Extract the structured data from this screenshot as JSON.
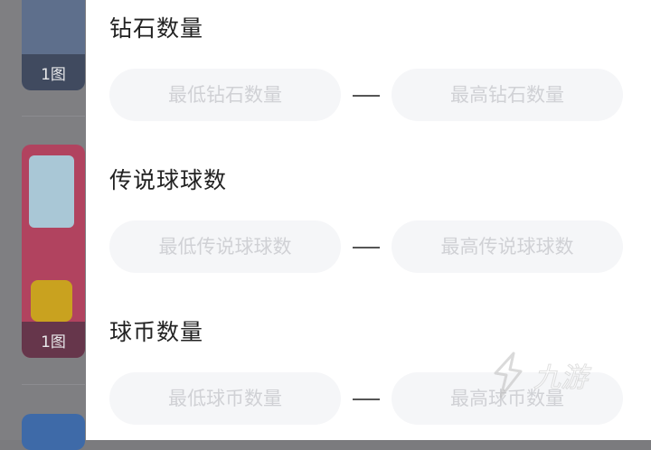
{
  "background": {
    "thumbnails": [
      {
        "badge": "1图"
      },
      {
        "badge": "1图"
      }
    ]
  },
  "filters": [
    {
      "title": "钻石数量",
      "min_placeholder": "最低钻石数量",
      "max_placeholder": "最高钻石数量"
    },
    {
      "title": "传说球球数",
      "min_placeholder": "最低传说球球数",
      "max_placeholder": "最高传说球球数"
    },
    {
      "title": "球币数量",
      "min_placeholder": "最低球币数量",
      "max_placeholder": "最高球币数量"
    }
  ],
  "watermark": {
    "text": "九游"
  },
  "colors": {
    "input_bg": "#f5f6f8",
    "placeholder": "#d0d1d5",
    "title": "#222222"
  }
}
